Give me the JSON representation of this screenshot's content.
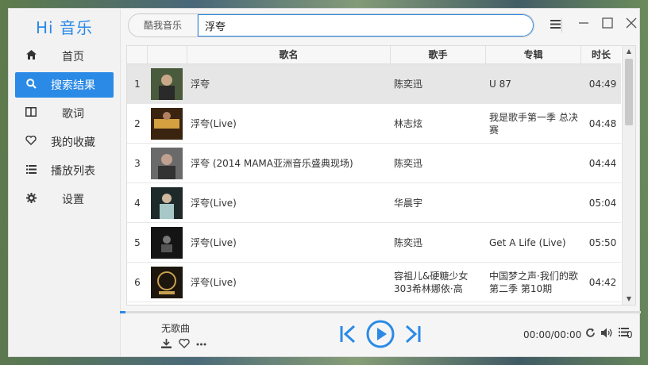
{
  "app": {
    "title": "Hi 音乐",
    "accent": "#2b8ae6"
  },
  "sidebar": {
    "items": [
      {
        "label": "首页",
        "icon": "home-icon"
      },
      {
        "label": "搜索结果",
        "icon": "search-icon",
        "active": true
      },
      {
        "label": "歌词",
        "icon": "lyrics-icon"
      },
      {
        "label": "我的收藏",
        "icon": "heart-icon"
      },
      {
        "label": "播放列表",
        "icon": "list-icon"
      },
      {
        "label": "设置",
        "icon": "gear-icon"
      }
    ]
  },
  "search": {
    "source": "酷我音乐",
    "value": "浮夸"
  },
  "table": {
    "headers": {
      "name": "歌名",
      "artist": "歌手",
      "album": "专辑",
      "duration": "时长"
    },
    "rows": [
      {
        "num": "1",
        "name": "浮夸",
        "artist": "陈奕迅",
        "album": "U 87",
        "duration": "04:49",
        "selected": true,
        "cover": "#4a5a3c"
      },
      {
        "num": "2",
        "name": "浮夸(Live)",
        "artist": "林志炫",
        "album": "我是歌手第一季 总决赛",
        "duration": "04:48",
        "cover": "#7a4a20"
      },
      {
        "num": "3",
        "name": "浮夸 (2014 MAMA亚洲音乐盛典现场)",
        "artist": "陈奕迅",
        "album": "",
        "duration": "04:44",
        "cover": "#555555"
      },
      {
        "num": "4",
        "name": "浮夸(Live)",
        "artist": "华晨宇",
        "album": "",
        "duration": "05:04",
        "cover": "#8aa0a0"
      },
      {
        "num": "5",
        "name": "浮夸(Live)",
        "artist": "陈奕迅",
        "album": "Get A Life (Live)",
        "duration": "05:50",
        "cover": "#1a1a1a"
      },
      {
        "num": "6",
        "name": "浮夸(Live)",
        "artist": "容祖儿&硬糖少女303希林娜依·高",
        "album": "中国梦之声·我们的歌第二季 第10期",
        "duration": "04:42",
        "cover": "#2a2218"
      }
    ]
  },
  "player": {
    "now_playing": "无歌曲",
    "time": "00:00/00:00",
    "queue_count": "0",
    "progress": 0.01
  }
}
